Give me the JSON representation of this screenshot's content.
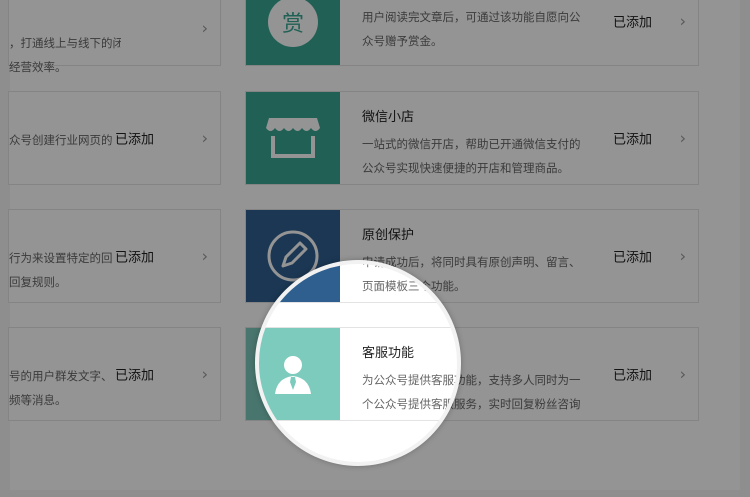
{
  "colors": {
    "teal": "#3aa893",
    "teal_light": "#7ccbbd",
    "blue_gray": "#2f5f8f",
    "overlay": "rgba(0,0,0,0.42)"
  },
  "left_column": [
    {
      "desc_line1": "，打通线上与线下的闭",
      "desc_line2": "经营效率。",
      "status": ""
    },
    {
      "desc_line1": "众号创建行业网页的",
      "desc_line2": "",
      "status": "已添加"
    },
    {
      "desc_line1": "行为来设置特定的回",
      "desc_line2": "回复规则。",
      "status": "已添加"
    },
    {
      "desc_line1": "号的用户群发文字、",
      "desc_line2": "频等消息。",
      "status": "已添加"
    }
  ],
  "right_column": [
    {
      "icon": "reward-icon",
      "icon_text": "赏",
      "name": "",
      "desc_line1": "用户阅读完文章后，可通过该功能自愿向公",
      "desc_line2": "众号赠予赏金。",
      "status": "已添加"
    },
    {
      "icon": "shop-icon",
      "name": "微信小店",
      "desc_line1": "一站式的微信开店，帮助已开通微信支付的",
      "desc_line2": "公众号实现快速便捷的开店和管理商品。",
      "status": "已添加"
    },
    {
      "icon": "pencil-icon",
      "name": "原创保护",
      "desc_line1": "申请成功后，将同时具有原创声明、留言、",
      "desc_line2": "页面模板三个功能。",
      "status": "已添加"
    },
    {
      "icon": "customer-service-icon",
      "name": "客服功能",
      "desc_line1": "为公众号提供客服功能，支持多人同时为一",
      "desc_line2": "个公众号提供客服服务，实时回复粉丝咨询",
      "status": "已添加"
    }
  ]
}
